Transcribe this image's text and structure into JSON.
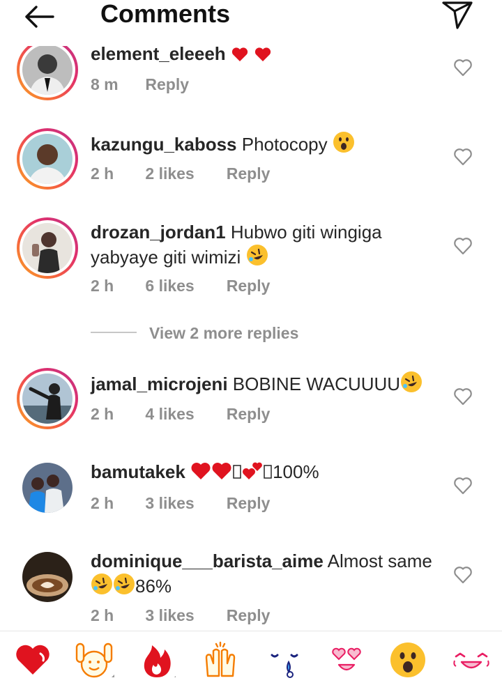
{
  "header": {
    "title": "Comments",
    "back_icon": "arrow-left-icon",
    "send_icon": "paper-plane-icon"
  },
  "comments": [
    {
      "username": "element_eleeeh",
      "text": "",
      "time": "8 m",
      "likes": "",
      "reply": "Reply",
      "avatar": "photo-man-suit",
      "story_ring": true
    },
    {
      "username": "kazungu_kaboss",
      "text": "Photocopy",
      "time": "2 h",
      "likes": "2 likes",
      "reply": "Reply",
      "avatar": "photo-man-smiling",
      "story_ring": true
    },
    {
      "username": "drozan_jordan1",
      "text": "Hubwo giti wingiga yabyaye giti wimizi",
      "time": "2 h",
      "likes": "6 likes",
      "reply": "Reply",
      "avatar": "photo-man-standing",
      "story_ring": true
    },
    {
      "username": "jamal_microjeni",
      "text": "BOBINE WACUUUU",
      "time": "2 h",
      "likes": "4 likes",
      "reply": "Reply",
      "avatar": "photo-man-pointing",
      "story_ring": true
    },
    {
      "username": "bamutakek",
      "text": "100%",
      "time": "2 h",
      "likes": "3 likes",
      "reply": "Reply",
      "avatar": "photo-children",
      "story_ring": false
    },
    {
      "username": "dominique___barista_aime",
      "text": "Almost same",
      "text2": "86%",
      "time": "2 h",
      "likes": "3 likes",
      "reply": "Reply",
      "avatar": "photo-latte-art",
      "story_ring": false
    }
  ],
  "view_more_replies": "View 2 more replies",
  "reactions": [
    "red-heart-icon",
    "raising-hands-icon",
    "fire-icon",
    "clapping-hands-icon",
    "crying-face-icon",
    "heart-eyes-icon",
    "astonished-face-icon",
    "laughing-face-icon"
  ],
  "colors": {
    "ring_start": "#f9a825",
    "ring_end": "#c13584",
    "meta_gray": "#8e8e8e",
    "text": "#262626"
  }
}
